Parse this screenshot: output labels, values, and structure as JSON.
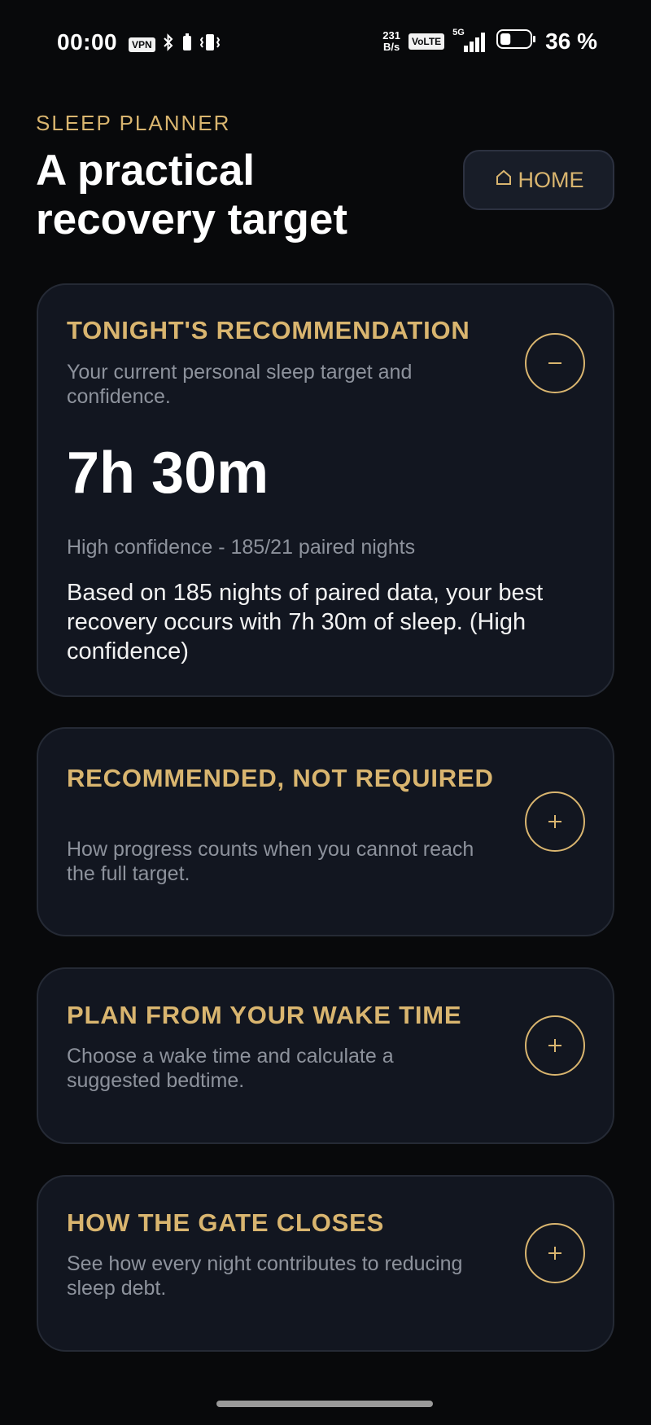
{
  "status_bar": {
    "time": "00:00",
    "vpn_label": "VPN",
    "net_speed_value": "231",
    "net_speed_unit": "B/s",
    "volte_label": "VoLTE",
    "network_label": "5G",
    "battery_percent": "36 %",
    "battery_level": 0.36
  },
  "header": {
    "eyebrow": "SLEEP PLANNER",
    "title": "A practical recovery target",
    "home_button_label": "HOME",
    "home_icon": "home-icon"
  },
  "cards": [
    {
      "title": "TONIGHT'S RECOMMENDATION",
      "subtitle": "Your current personal sleep target and confidence.",
      "expanded": true,
      "value": "7h 30m",
      "confidence": "High confidence - 185/21 paired nights",
      "explanation": "Based on 185 nights of paired data, your best recovery occurs with 7h 30m of sleep. (High confidence)"
    },
    {
      "title": "RECOMMENDED, NOT REQUIRED",
      "subtitle": "How progress counts when you cannot reach the full target.",
      "expanded": false
    },
    {
      "title": "PLAN FROM YOUR WAKE TIME",
      "subtitle": "Choose a wake time and calculate a suggested bedtime.",
      "expanded": false
    },
    {
      "title": "HOW THE GATE CLOSES",
      "subtitle": "See how every night contributes to reducing sleep debt.",
      "expanded": false
    }
  ],
  "colors": {
    "background": "#08090b",
    "card": "#121620",
    "accent": "#d9b56f",
    "muted_text": "#8d929c"
  }
}
